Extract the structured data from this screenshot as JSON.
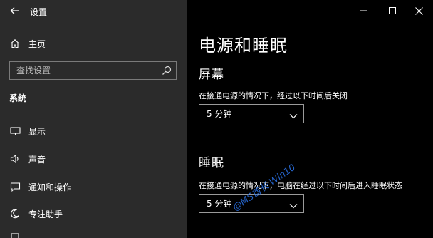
{
  "app_title": "设置",
  "sidebar": {
    "home_label": "主页",
    "search_placeholder": "查找设置",
    "section_heading": "系统",
    "items": [
      {
        "label": "显示",
        "icon": "monitor-icon"
      },
      {
        "label": "声音",
        "icon": "speaker-icon"
      },
      {
        "label": "通知和操作",
        "icon": "notification-icon"
      },
      {
        "label": "专注助手",
        "icon": "focus-assist-icon"
      }
    ]
  },
  "main": {
    "page_title": "电源和睡眠",
    "screen": {
      "heading": "屏幕",
      "description": "在接通电源的情况下，经过以下时间后关闭",
      "selected": "5 分钟"
    },
    "sleep": {
      "heading": "睡眠",
      "description": "在接通电源的情况下，电脑在经过以下时间后进入睡眠状态",
      "selected": "5 分钟"
    }
  },
  "watermark": "@MS酋长 Win10",
  "colors": {
    "sidebar_bg": "#2b2b2b",
    "content_bg": "#000000",
    "watermark": "#2a6fe0"
  }
}
